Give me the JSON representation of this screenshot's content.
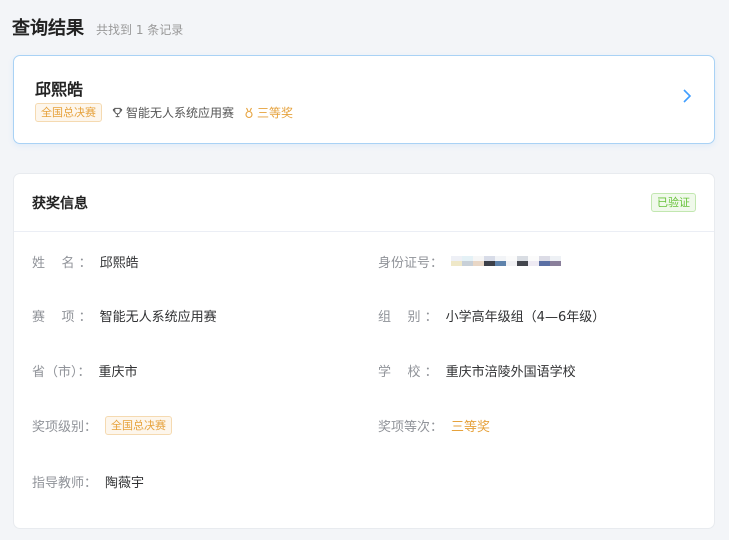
{
  "header": {
    "title": "查询结果",
    "subtitle": "共找到 1 条记录"
  },
  "result": {
    "name": "邱熙皓",
    "level_tag": "全国总决赛",
    "event": "智能无人系统应用赛",
    "prize": "三等奖"
  },
  "info": {
    "title": "获奖信息",
    "verified": "已验证",
    "fields": {
      "name": {
        "label": "姓    名 ：",
        "value": "邱熙皓"
      },
      "id": {
        "label": "身份证号：",
        "value": ""
      },
      "event": {
        "label": "赛    项 ：",
        "value": "智能无人系统应用赛"
      },
      "group": {
        "label": "组    别 ：",
        "value": "小学高年级组（4—6年级）"
      },
      "province": {
        "label": "省（市）：",
        "value": "重庆市"
      },
      "school": {
        "label": "学    校 ：",
        "value": "重庆市涪陵外国语学校"
      },
      "level": {
        "label": "奖项级别：",
        "value": "全国总决赛"
      },
      "prize": {
        "label": "奖项等次：",
        "value": "三等奖"
      },
      "teacher": {
        "label": "指导教师：",
        "value": "陶薇宇"
      }
    }
  },
  "colors": {
    "accent_blue": "#409eff",
    "prize_orange": "#e6a23c",
    "verified_green": "#67c23a"
  },
  "icons": {
    "trophy": "trophy-icon",
    "medal": "medal-icon",
    "chevron": "chevron-right-icon"
  }
}
